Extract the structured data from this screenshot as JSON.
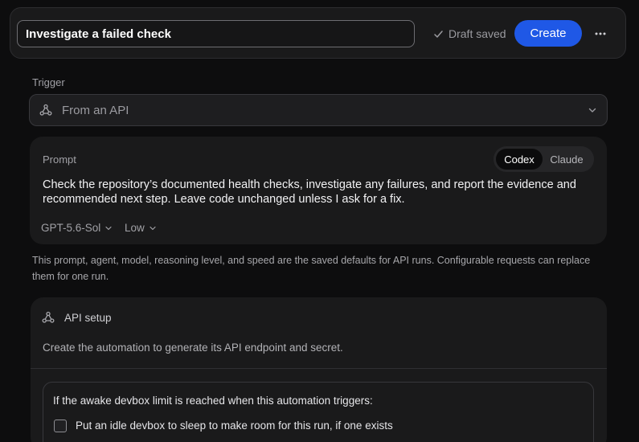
{
  "header": {
    "automation_name": "Investigate a failed check",
    "draft_status": "Draft saved",
    "create_label": "Create"
  },
  "trigger": {
    "label": "Trigger",
    "selected": "From an API"
  },
  "prompt": {
    "label": "Prompt",
    "agents": [
      "Codex",
      "Claude"
    ],
    "selected_agent": "Codex",
    "text": "Check the repository’s documented health checks, investigate any failures, and report the evidence and recommended next step. Leave code unchanged unless I ask for a fix.",
    "model": "GPT-5.6-Sol",
    "reasoning": "Low"
  },
  "help_text": "This prompt, agent, model, reasoning level, and speed are the saved defaults for API runs. Configurable requests can replace them for one run.",
  "api_setup": {
    "title": "API setup",
    "description": "Create the automation to generate its API endpoint and secret.",
    "limit_title": "If the awake devbox limit is reached when this automation triggers:",
    "sleep_option": "Put an idle devbox to sleep to make room for this run, if one exists",
    "sleep_option_checked": false
  },
  "colors": {
    "accent": "#1f58e6",
    "background": "#0d0d0e",
    "card": "#1a1a1b"
  },
  "icons": [
    "check-icon",
    "more-icon",
    "webhook-icon",
    "chevron-down-icon"
  ]
}
